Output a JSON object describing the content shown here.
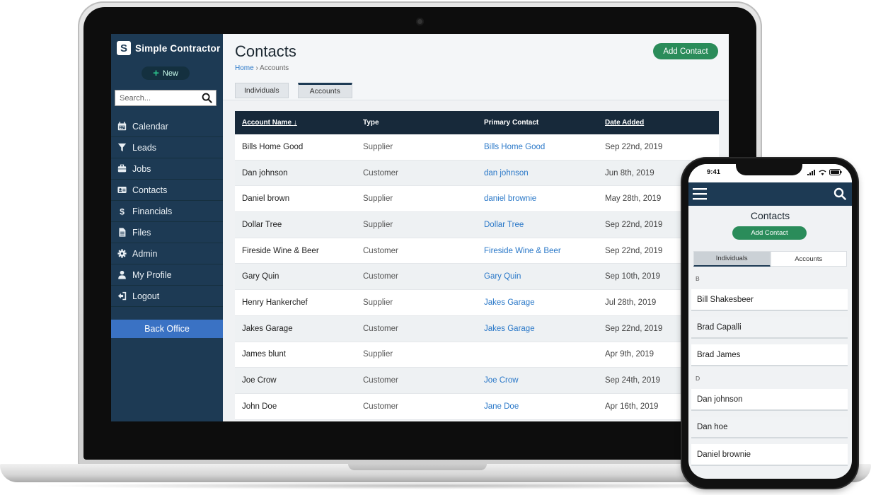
{
  "app": {
    "brand_name": "Simple Contractor",
    "brand_logo_letter": "S",
    "new_label": "New",
    "search_placeholder": "Search...",
    "back_office_label": "Back Office"
  },
  "sidebar": {
    "items": [
      {
        "label": "Calendar",
        "icon": "calendar-icon"
      },
      {
        "label": "Leads",
        "icon": "filter-icon"
      },
      {
        "label": "Jobs",
        "icon": "briefcase-icon"
      },
      {
        "label": "Contacts",
        "icon": "contact-card-icon"
      },
      {
        "label": "Financials",
        "icon": "dollar-icon"
      },
      {
        "label": "Files",
        "icon": "file-icon"
      },
      {
        "label": "Admin",
        "icon": "gear-icon"
      },
      {
        "label": "My Profile",
        "icon": "user-icon"
      },
      {
        "label": "Logout",
        "icon": "logout-icon"
      }
    ]
  },
  "main": {
    "title": "Contacts",
    "breadcrumb": {
      "home": "Home",
      "separator": "›",
      "current": "Accounts"
    },
    "add_contact_label": "Add Contact",
    "tabs": [
      {
        "label": "Individuals",
        "active": false
      },
      {
        "label": "Accounts",
        "active": true
      }
    ],
    "table": {
      "columns": [
        "Account Name",
        "Type",
        "Primary Contact",
        "Date Added"
      ],
      "sort_indicator": "↓",
      "rows": [
        [
          "Bills Home Good",
          "Supplier",
          "Bills Home Good",
          "Sep 22nd, 2019"
        ],
        [
          "Dan johnson",
          "Customer",
          "dan johnson",
          "Jun 8th, 2019"
        ],
        [
          "Daniel brown",
          "Supplier",
          "daniel brownie",
          "May 28th, 2019"
        ],
        [
          "Dollar Tree",
          "Supplier",
          "Dollar Tree",
          "Sep 22nd, 2019"
        ],
        [
          "Fireside Wine & Beer",
          "Customer",
          "Fireside Wine & Beer",
          "Sep 22nd, 2019"
        ],
        [
          "Gary Quin",
          "Customer",
          "Gary Quin",
          "Sep 10th, 2019"
        ],
        [
          "Henry Hankerchef",
          "Supplier",
          "Jakes Garage",
          "Jul 28th, 2019"
        ],
        [
          "Jakes Garage",
          "Customer",
          "Jakes Garage",
          "Sep 22nd, 2019"
        ],
        [
          "James blunt",
          "Supplier",
          "",
          "Apr 9th, 2019"
        ],
        [
          "Joe Crow",
          "Customer",
          "Joe Crow",
          "Sep 24th, 2019"
        ],
        [
          "John Doe",
          "Customer",
          "Jane Doe",
          "Apr 16th, 2019"
        ]
      ]
    }
  },
  "mobile": {
    "time": "9:41",
    "title": "Contacts",
    "add_contact_label": "Add Contact",
    "tabs": [
      {
        "label": "Individuals",
        "active": true
      },
      {
        "label": "Accounts",
        "active": false
      }
    ],
    "sections": [
      {
        "letter": "B",
        "items": [
          "Bill Shakesbeer",
          "Brad Capalli",
          "Brad James"
        ]
      },
      {
        "letter": "D",
        "items": [
          "Dan johnson",
          "Dan hoe",
          "Daniel brownie"
        ]
      }
    ]
  },
  "colors": {
    "sidebar": "#1d3a54",
    "table_header": "#17293a",
    "accent_green": "#2a8c5a",
    "link_blue": "#2a78c8",
    "back_office_blue": "#3a72c4"
  }
}
